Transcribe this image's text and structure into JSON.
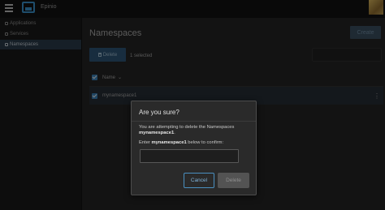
{
  "app": {
    "brand": "Epinio"
  },
  "sidebar": {
    "items": [
      {
        "label": "Applications",
        "active": false
      },
      {
        "label": "Services",
        "active": false
      },
      {
        "label": "Namespaces",
        "active": true
      }
    ]
  },
  "main": {
    "title": "Namespaces",
    "create_label": "Create",
    "delete_label": "Delete",
    "selected_text": "1 selected",
    "table": {
      "column_name": "Name",
      "rows": [
        {
          "name": "mynamespace1"
        }
      ]
    }
  },
  "dialog": {
    "title": "Are you sure?",
    "message_prefix": "You are attempting to delete the Namespaces",
    "namespace": "mynamespace1",
    "confirm_prefix": "Enter",
    "confirm_suffix": "below to confirm:",
    "input_value": "",
    "cancel_label": "Cancel",
    "delete_label": "Delete"
  },
  "colors": {
    "accent": "#3a7fb4",
    "delete_button": "#2d5373",
    "cancel_border": "#4a8fbf"
  }
}
